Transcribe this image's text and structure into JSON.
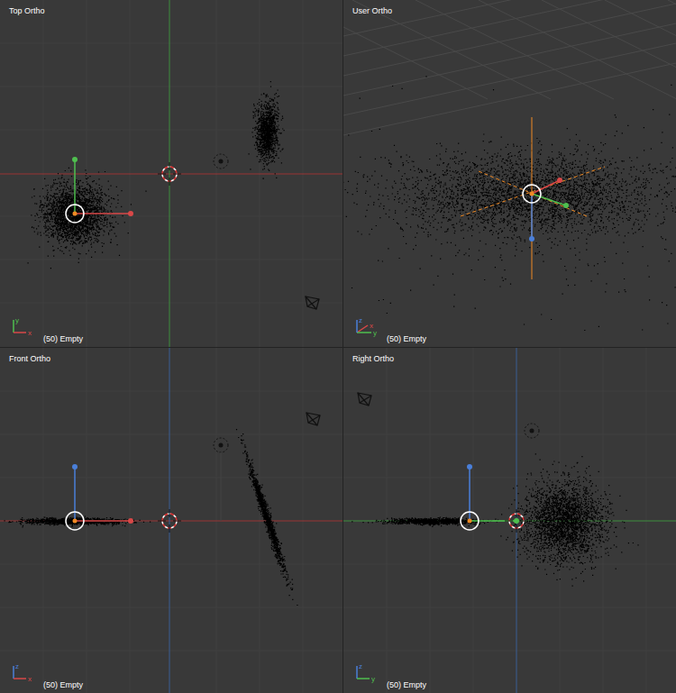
{
  "viewports": [
    {
      "label": "Top Ortho",
      "footer": "(50) Empty",
      "gizmo": [
        {
          "axis": "y",
          "color": "#4fbf4f"
        },
        {
          "axis": "x",
          "color": "#d94848"
        }
      ]
    },
    {
      "label": "User Ortho",
      "footer": "(50) Empty",
      "gizmo": [
        {
          "axis": "x",
          "color": "#d94848"
        },
        {
          "axis": "y",
          "color": "#4fbf4f"
        },
        {
          "axis": "z",
          "color": "#4a7fd9"
        }
      ]
    },
    {
      "label": "Front Ortho",
      "footer": "(50) Empty",
      "gizmo": [
        {
          "axis": "z",
          "color": "#4a7fd9"
        },
        {
          "axis": "x",
          "color": "#d94848"
        }
      ]
    },
    {
      "label": "Right Ortho",
      "footer": "(50) Empty",
      "gizmo": [
        {
          "axis": "z",
          "color": "#4a7fd9"
        },
        {
          "axis": "y",
          "color": "#4fbf4f"
        }
      ]
    }
  ]
}
